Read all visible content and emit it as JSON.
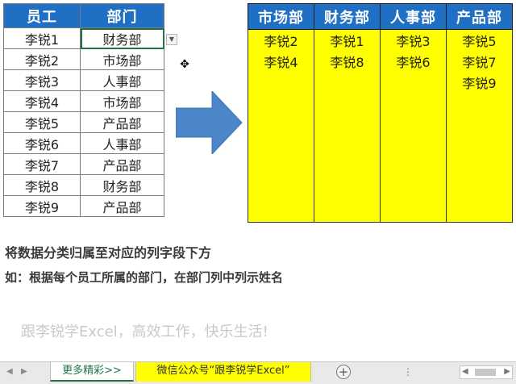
{
  "left_table": {
    "headers": [
      "员工",
      "部门"
    ],
    "rows": [
      [
        "李锐1",
        "财务部"
      ],
      [
        "李锐2",
        "市场部"
      ],
      [
        "李锐3",
        "人事部"
      ],
      [
        "李锐4",
        "市场部"
      ],
      [
        "李锐5",
        "产品部"
      ],
      [
        "李锐6",
        "人事部"
      ],
      [
        "李锐7",
        "产品部"
      ],
      [
        "李锐8",
        "财务部"
      ],
      [
        "李锐9",
        "产品部"
      ]
    ]
  },
  "right_table": {
    "headers": [
      "市场部",
      "财务部",
      "人事部",
      "产品部"
    ],
    "columns": [
      [
        "李锐2",
        "李锐4"
      ],
      [
        "李锐1",
        "李锐8"
      ],
      [
        "李锐3",
        "李锐6"
      ],
      [
        "李锐5",
        "李锐7",
        "李锐9"
      ]
    ]
  },
  "texts": {
    "title": "将数据分类归属至对应的列字段下方",
    "subtitle": "如：根据每个员工所属的部门，在部门列中列示姓名",
    "slogan": "跟李锐学Excel，高效工作，快乐生活!"
  },
  "tabs": {
    "more": "更多精彩>>",
    "wechat": "微信公众号“跟李锐学Excel”",
    "add": "+",
    "dots": "⋮"
  },
  "icons": {
    "dropdown": "chevron-down-icon",
    "cursor": "cell-cursor-icon",
    "arrow": "right-arrow-icon"
  },
  "colors": {
    "header_blue": "#1f6fc4",
    "highlight_yellow": "#ffff00",
    "arrow_blue": "#4a86c8"
  }
}
